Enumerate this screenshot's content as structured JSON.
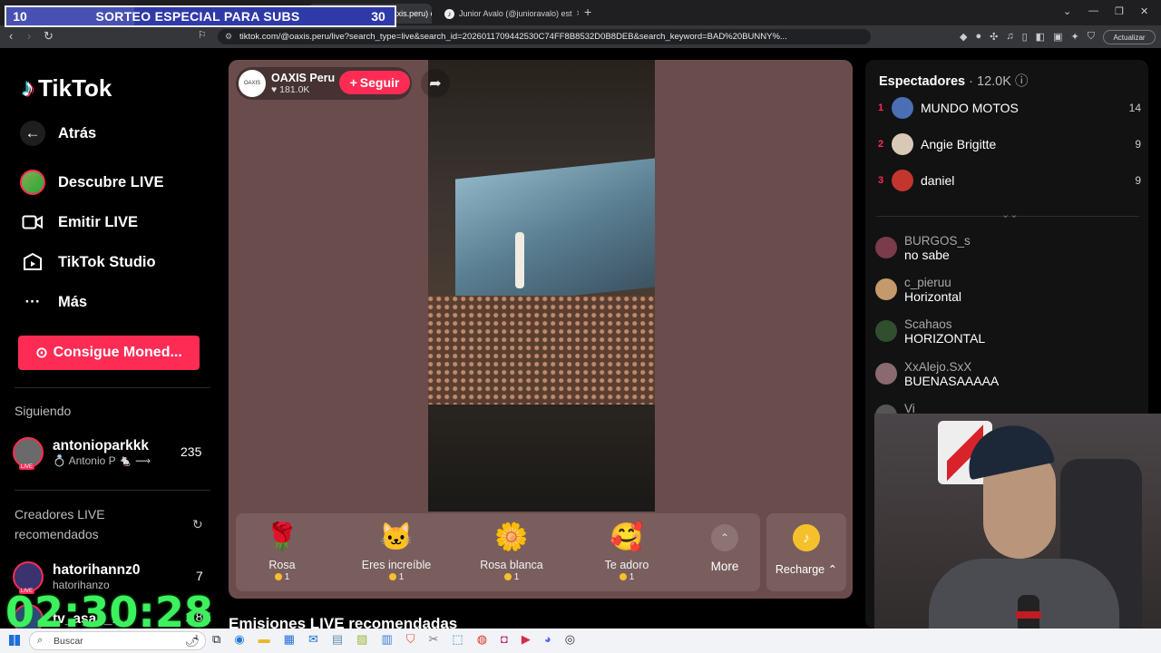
{
  "overlay": {
    "left_num": "10",
    "title": "SORTEO ESPECIAL PARA SUBS",
    "right_num": "30",
    "timer": "02:30:28"
  },
  "browser": {
    "tabs": [
      {
        "label": "OAXIS Peru (@oaxis.peru) en",
        "active": true
      },
      {
        "label": "Junior Avalo (@junioravalo) est",
        "active": false
      }
    ],
    "new_tab": "+",
    "url": "tiktok.com/@oaxis.peru/live?search_type=live&search_id=2026011709442530C74FF8B8532D0B8DEB&search_keyword=BAD%20BUNNY%...",
    "update_label": "Actualizar"
  },
  "sidebar": {
    "logo": "TikTok",
    "back": "Atrás",
    "nav": [
      {
        "label": "Descubre LIVE",
        "icon": "live-avatar-icon"
      },
      {
        "label": "Emitir LIVE",
        "icon": "camera-icon"
      },
      {
        "label": "TikTok Studio",
        "icon": "studio-icon"
      },
      {
        "label": "Más",
        "icon": "more-icon"
      }
    ],
    "coins_button": "Consigue Moned...",
    "following_title": "Siguiendo",
    "following": [
      {
        "name": "antonioparkkk",
        "sub": "💍 Antonio P 🐁 ⟿",
        "count": "235"
      }
    ],
    "recommended_title": "Creadores LIVE recomendados",
    "recommended": [
      {
        "name": "hatorihannz0",
        "sub": "hatorihanzo",
        "count": "7"
      },
      {
        "name": "tv_asali_li...",
        "sub": "",
        "count": "1.8K"
      }
    ]
  },
  "stream": {
    "host_name": "OAXIS Peru",
    "likes": "181.0K",
    "follow_label": "Seguir",
    "gifts": [
      {
        "name": "Rosa",
        "price": "1",
        "emoji": "🌹"
      },
      {
        "name": "Eres increíble",
        "price": "1",
        "emoji": "🐱"
      },
      {
        "name": "Rosa blanca",
        "price": "1",
        "emoji": "🌼"
      },
      {
        "name": "Te adoro",
        "price": "1",
        "emoji": "🥰"
      }
    ],
    "more_label": "More",
    "recharge_label": "Recharge"
  },
  "recs_title": "Emisiones LIVE recomendadas",
  "viewers": {
    "title": "Espectadores",
    "count": "12.0K",
    "top": [
      {
        "rank": "1",
        "name": "MUNDO MOTOS",
        "score": "14",
        "color": "#4a6fb5"
      },
      {
        "rank": "2",
        "name": "Angie Brigitte",
        "score": "9",
        "color": "#d8c9b7"
      },
      {
        "rank": "3",
        "name": "daniel",
        "score": "9",
        "color": "#c2362e"
      }
    ]
  },
  "comments": [
    {
      "user": "BURGOS_s",
      "text": "no sabe",
      "color": "#7a3b4a"
    },
    {
      "user": "c_pieruu",
      "text": "Horizontal",
      "color": "#c49a6c"
    },
    {
      "user": "Scahaos",
      "text": "HORIZONTAL",
      "color": "#2f4f2f"
    },
    {
      "user": "XxAlejo.SxX",
      "text": "BUENASAAAAA",
      "color": "#8a6a70"
    },
    {
      "user": "Vi",
      "text": "",
      "color": "#555555"
    }
  ],
  "taskbar": {
    "search_placeholder": "Buscar"
  }
}
